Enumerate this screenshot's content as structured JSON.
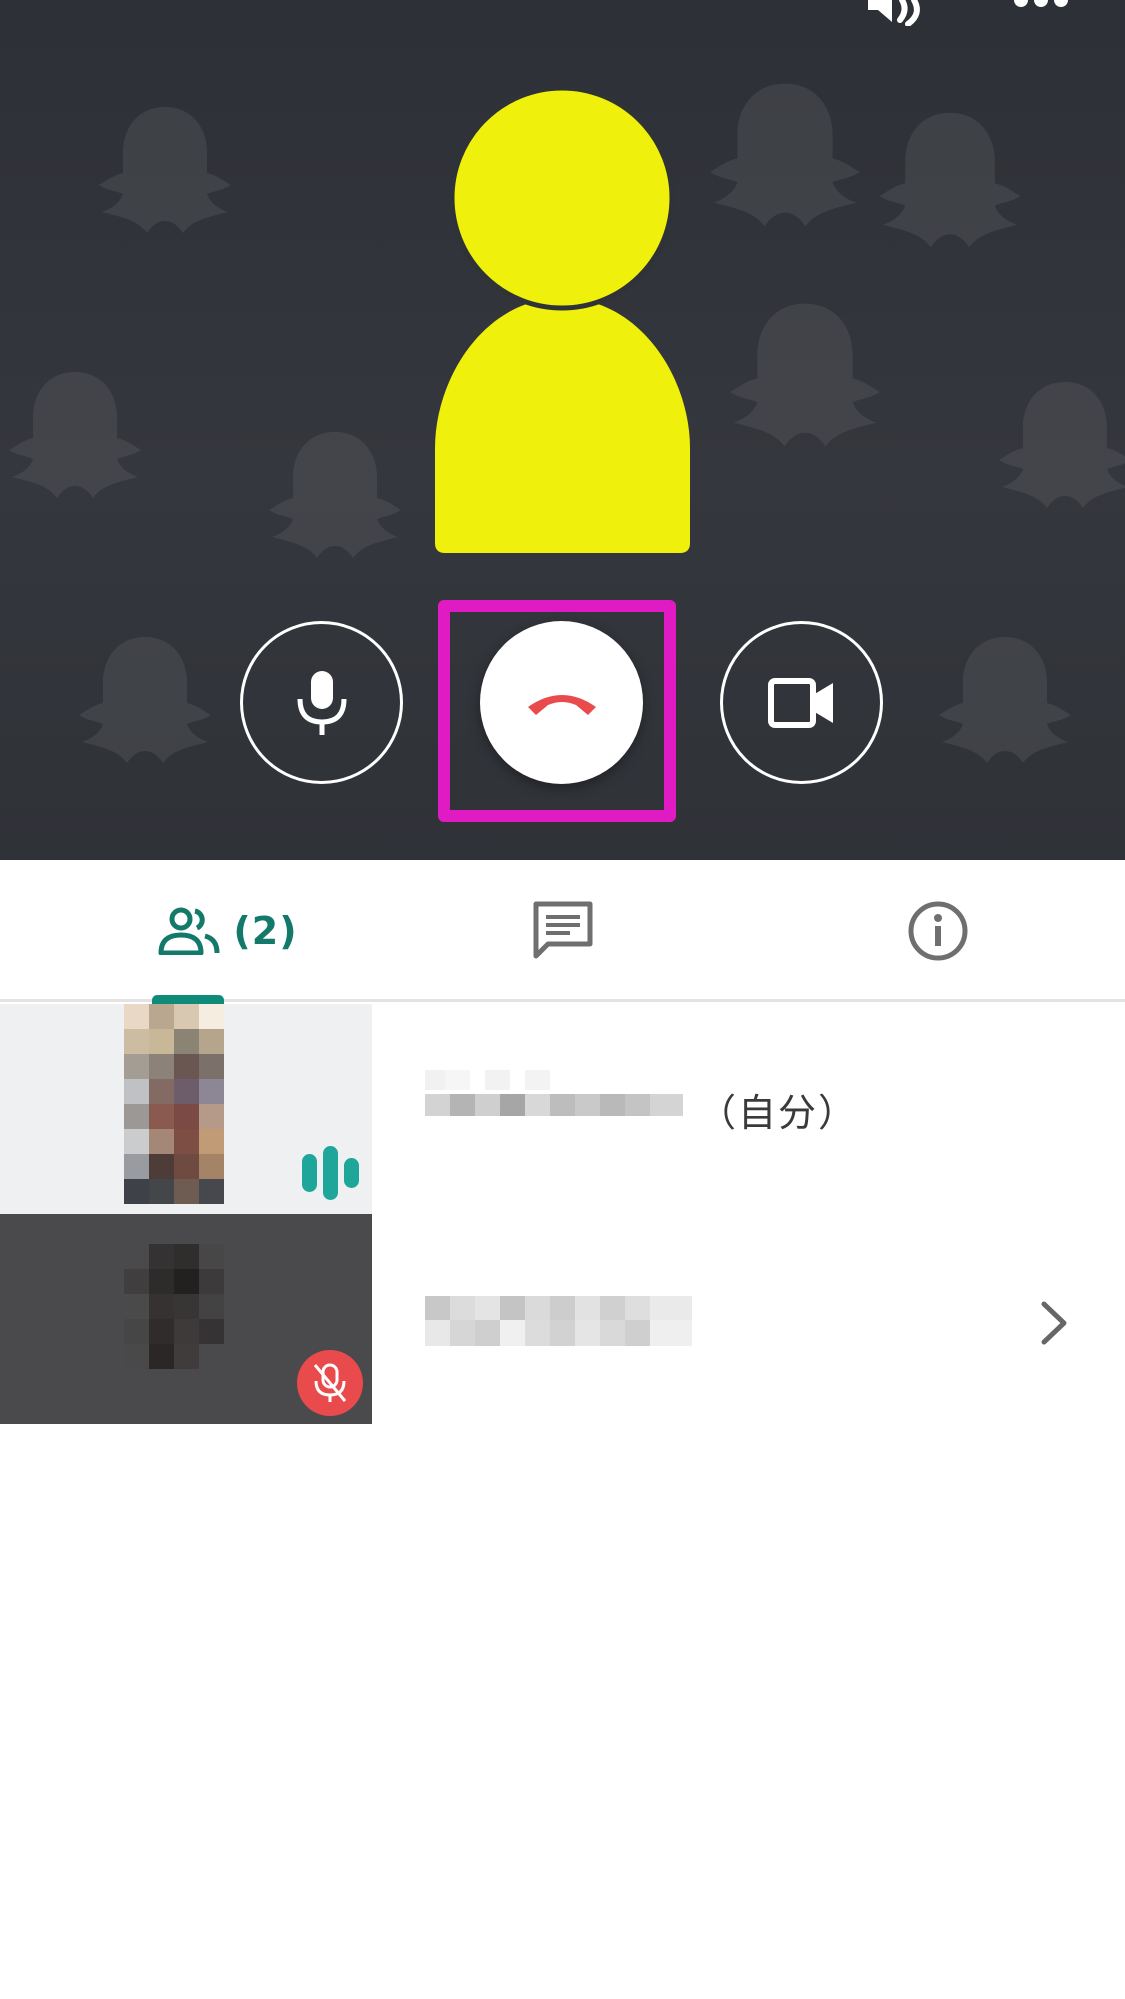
{
  "call": {
    "buttons": {
      "mic": "microphone",
      "hangup": "end-call",
      "camera": "video-camera"
    },
    "highlight_color": "#e01bc4",
    "avatar_color": "#eff00b",
    "hangup_icon_color": "#e94a4c"
  },
  "tabs": [
    {
      "id": "people",
      "icon": "people-icon",
      "count_label": "(2)",
      "active": true
    },
    {
      "id": "chat",
      "icon": "chat-icon"
    },
    {
      "id": "info",
      "icon": "info-icon"
    }
  ],
  "accent_color": "#12796b",
  "participants": [
    {
      "name": "",
      "self_label": "（自分）",
      "status": "speaking"
    },
    {
      "name": "",
      "status": "muted"
    }
  ]
}
